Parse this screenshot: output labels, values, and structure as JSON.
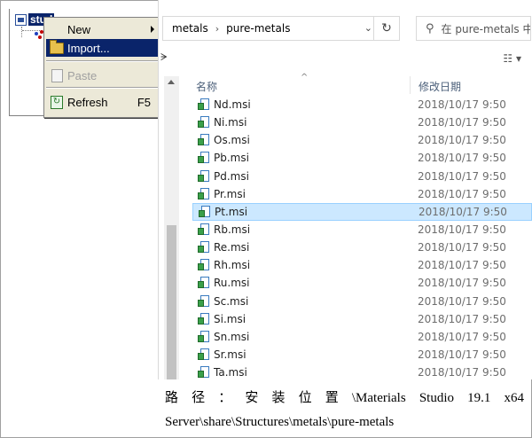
{
  "tree": {
    "root_label": "stud"
  },
  "context_menu": {
    "items": [
      {
        "label": "New",
        "shortcut": "",
        "state": "normal",
        "icon": "none",
        "submenu": true
      },
      {
        "label": "Import...",
        "shortcut": "",
        "state": "selected",
        "icon": "folder-icon",
        "submenu": false
      },
      {
        "label": "Paste",
        "shortcut": "",
        "state": "disabled",
        "icon": "paste-icon",
        "submenu": false
      },
      {
        "label": "Refresh",
        "shortcut": "F5",
        "state": "normal",
        "icon": "refresh-icon",
        "submenu": false
      }
    ]
  },
  "explorer": {
    "breadcrumb": [
      "metals",
      "pure-metals"
    ],
    "search_placeholder": "在 pure-metals 中",
    "columns": {
      "name": "名称",
      "date": "修改日期"
    },
    "files": [
      {
        "name": "Nd.msi",
        "date": "2018/10/17 9:50",
        "selected": false
      },
      {
        "name": "Ni.msi",
        "date": "2018/10/17 9:50",
        "selected": false
      },
      {
        "name": "Os.msi",
        "date": "2018/10/17 9:50",
        "selected": false
      },
      {
        "name": "Pb.msi",
        "date": "2018/10/17 9:50",
        "selected": false
      },
      {
        "name": "Pd.msi",
        "date": "2018/10/17 9:50",
        "selected": false
      },
      {
        "name": "Pr.msi",
        "date": "2018/10/17 9:50",
        "selected": false
      },
      {
        "name": "Pt.msi",
        "date": "2018/10/17 9:50",
        "selected": true
      },
      {
        "name": "Rb.msi",
        "date": "2018/10/17 9:50",
        "selected": false
      },
      {
        "name": "Re.msi",
        "date": "2018/10/17 9:50",
        "selected": false
      },
      {
        "name": "Rh.msi",
        "date": "2018/10/17 9:50",
        "selected": false
      },
      {
        "name": "Ru.msi",
        "date": "2018/10/17 9:50",
        "selected": false
      },
      {
        "name": "Sc.msi",
        "date": "2018/10/17 9:50",
        "selected": false
      },
      {
        "name": "Si.msi",
        "date": "2018/10/17 9:50",
        "selected": false
      },
      {
        "name": "Sn.msi",
        "date": "2018/10/17 9:50",
        "selected": false
      },
      {
        "name": "Sr.msi",
        "date": "2018/10/17 9:50",
        "selected": false
      },
      {
        "name": "Ta.msi",
        "date": "2018/10/17 9:50",
        "selected": false
      }
    ]
  },
  "caption": {
    "line1_parts": [
      "路",
      "径",
      "：",
      "安",
      "装",
      "位",
      "置",
      "\\Materials",
      "Studio",
      "19.1",
      "x64"
    ],
    "line2": "Server\\share\\Structures\\metals\\pure-metals"
  },
  "colors": {
    "selection_menu": "#0a246a",
    "selection_row": "#cce8ff"
  }
}
